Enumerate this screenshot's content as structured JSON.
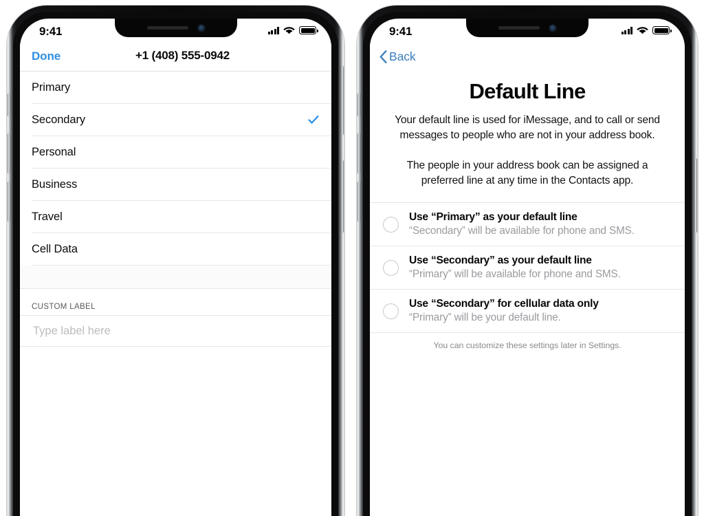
{
  "left_phone": {
    "status_bar": {
      "time": "9:41",
      "signal_icon": "cellular-signal-icon",
      "wifi_icon": "wifi-icon",
      "battery_icon": "battery-icon"
    },
    "nav": {
      "done_label": "Done",
      "title": "+1 (408) 555-0942"
    },
    "label_options": [
      {
        "label": "Primary",
        "checked": false
      },
      {
        "label": "Secondary",
        "checked": true
      },
      {
        "label": "Personal",
        "checked": false
      },
      {
        "label": "Business",
        "checked": false
      },
      {
        "label": "Travel",
        "checked": false
      },
      {
        "label": "Cell Data",
        "checked": false
      }
    ],
    "custom_section": {
      "header": "CUSTOM LABEL",
      "input_value": "",
      "input_placeholder": "Type label here"
    },
    "accent_color": "#2f8ee0",
    "checkmark_color": "#1e8ae8"
  },
  "right_phone": {
    "status_bar": {
      "time": "9:41",
      "signal_icon": "cellular-signal-icon",
      "wifi_icon": "wifi-icon",
      "battery_icon": "battery-icon"
    },
    "nav": {
      "back_label": "Back",
      "back_icon": "chevron-left-icon"
    },
    "title": "Default Line",
    "paragraphs": [
      "Your default line is used for iMessage, and to call or send messages to people who are not in your address book.",
      "The people in your address book can be assigned a preferred line at any time in the Contacts app."
    ],
    "options": [
      {
        "title": "Use “Primary” as your default line",
        "subtitle": "“Secondary” will be available for phone and SMS.",
        "selected": false
      },
      {
        "title": "Use “Secondary” as your default line",
        "subtitle": "“Primary” will be available for phone and SMS.",
        "selected": false
      },
      {
        "title": "Use “Secondary” for cellular data only",
        "subtitle": "“Primary” will be your default line.",
        "selected": false
      }
    ],
    "footer": "You can customize these settings later in Settings.",
    "accent_color": "#3a7fbd"
  }
}
